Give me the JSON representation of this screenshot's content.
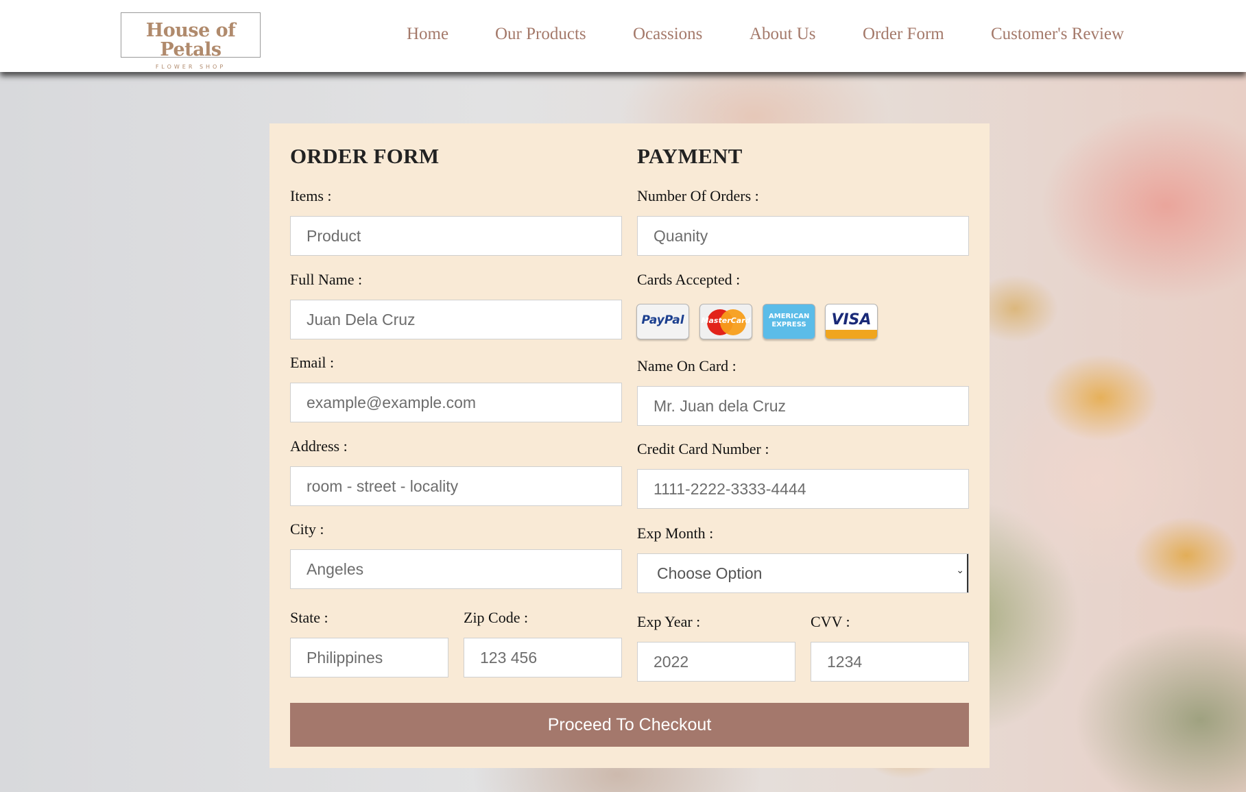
{
  "header": {
    "logo": {
      "title": "House of Petals",
      "subtitle": "FLOWER SHOP"
    },
    "nav": [
      "Home",
      "Our Products",
      "Ocassions",
      "About Us",
      "Order Form",
      "Customer's Review"
    ]
  },
  "order_form": {
    "title": "ORDER FORM",
    "fields": {
      "items": {
        "label": "Items :",
        "placeholder": "Product"
      },
      "full_name": {
        "label": "Full Name :",
        "placeholder": "Juan Dela Cruz"
      },
      "email": {
        "label": "Email :",
        "placeholder": "example@example.com"
      },
      "address": {
        "label": "Address :",
        "placeholder": "room - street - locality"
      },
      "city": {
        "label": "City :",
        "placeholder": "Angeles"
      },
      "state": {
        "label": "State :",
        "placeholder": "Philippines"
      },
      "zip": {
        "label": "Zip Code :",
        "placeholder": "123 456"
      }
    }
  },
  "payment": {
    "title": "PAYMENT",
    "fields": {
      "orders": {
        "label": "Number Of Orders :",
        "placeholder": "Quanity"
      },
      "cards_label": "Cards Accepted :",
      "name_on_card": {
        "label": "Name On Card :",
        "placeholder": "Mr. Juan dela Cruz"
      },
      "card_number": {
        "label": "Credit Card Number :",
        "placeholder": "1111-2222-3333-4444"
      },
      "exp_month": {
        "label": "Exp Month :",
        "selected": "Choose Option"
      },
      "exp_year": {
        "label": "Exp Year :",
        "placeholder": "2022"
      },
      "cvv": {
        "label": "CVV :",
        "placeholder": "1234"
      }
    },
    "cards": [
      {
        "name": "paypal-logo",
        "text": "PayPal"
      },
      {
        "name": "mastercard-logo",
        "text": "MasterCard"
      },
      {
        "name": "amex-logo",
        "text": "AMERICAN EXPRESS"
      },
      {
        "name": "visa-logo",
        "text": "VISA"
      }
    ]
  },
  "submit_label": "Proceed To Checkout",
  "colors": {
    "accent": "#a4786c",
    "nav_text": "#a4796a",
    "panel": "#f9ead6",
    "logo": "#b08a6c"
  }
}
